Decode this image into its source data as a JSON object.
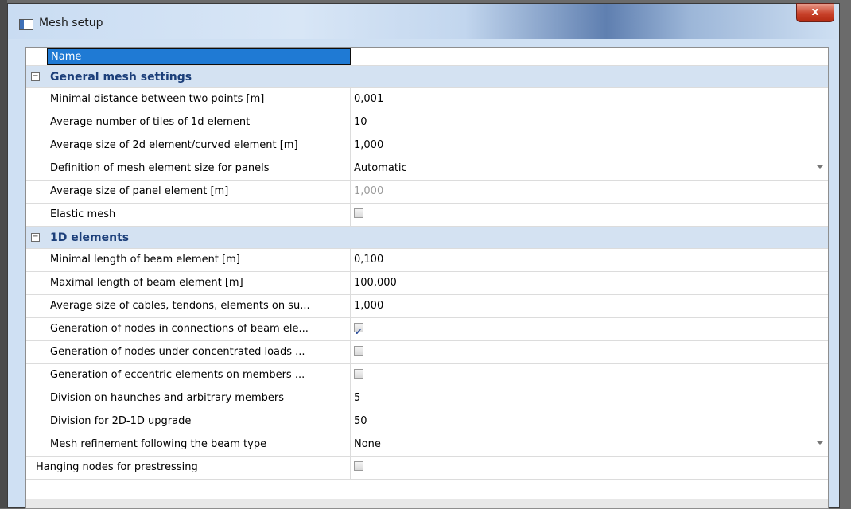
{
  "window": {
    "title": "Mesh setup",
    "close_label": "x"
  },
  "header": {
    "name_label": "Name",
    "value": ""
  },
  "groups": [
    {
      "label": "General mesh settings",
      "toggle": "−",
      "rows": [
        {
          "label": "Minimal distance between two points [m]",
          "value": "0,001"
        },
        {
          "label": "Average number of tiles of 1d element",
          "value": "10"
        },
        {
          "label": "Average size of 2d element/curved element [m]",
          "value": "1,000"
        },
        {
          "label": "Definition of mesh element size for panels",
          "value": "Automatic"
        },
        {
          "label": "Average size of panel element [m]",
          "value": "1,000"
        },
        {
          "label": "Elastic mesh",
          "checked": false
        }
      ]
    },
    {
      "label": "1D elements",
      "toggle": "−",
      "rows": [
        {
          "label": "Minimal length of beam element [m]",
          "value": "0,100"
        },
        {
          "label": "Maximal length of beam element [m]",
          "value": "100,000"
        },
        {
          "label": "Average size of cables, tendons, elements on su...",
          "value": "1,000"
        },
        {
          "label": "Generation of nodes in connections of beam ele...",
          "checked": true
        },
        {
          "label": "Generation of nodes under concentrated loads ...",
          "checked": false
        },
        {
          "label": "Generation of eccentric elements on members ...",
          "checked": false
        },
        {
          "label": "Division on haunches and arbitrary members",
          "value": "5"
        },
        {
          "label": "Division for 2D-1D upgrade",
          "value": "50"
        },
        {
          "label": "Mesh refinement following the beam type",
          "value": "None"
        }
      ]
    }
  ],
  "outer_row": {
    "label": "Hanging nodes for prestressing",
    "checked": false
  }
}
